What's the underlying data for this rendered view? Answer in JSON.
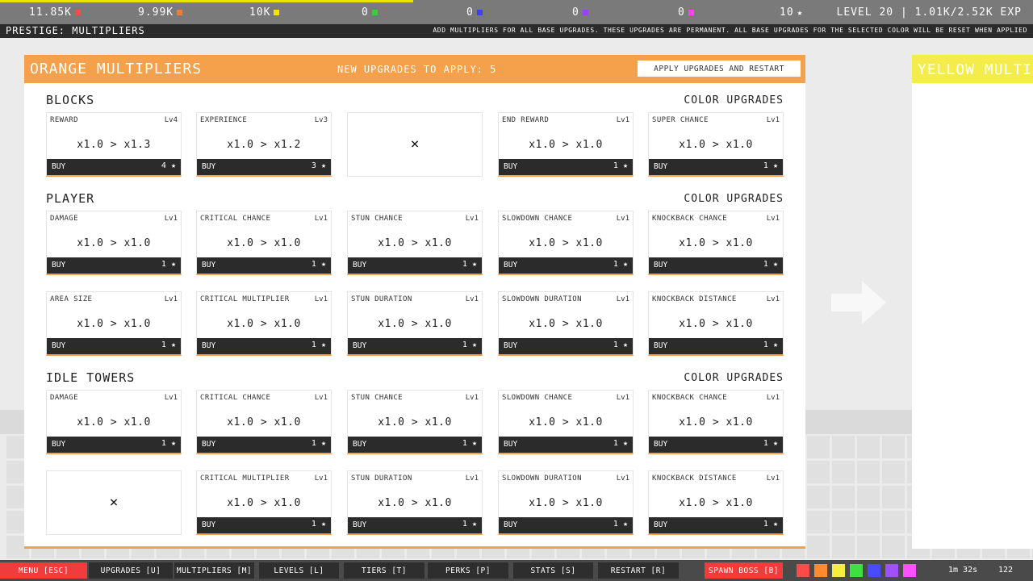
{
  "top": {
    "resources": [
      {
        "value": "11.85K",
        "color": "#ff4a4a"
      },
      {
        "value": "9.99K",
        "color": "#ff7a30"
      },
      {
        "value": "10K",
        "color": "#f5e400"
      },
      {
        "value": "0",
        "color": "#38d038"
      },
      {
        "value": "0",
        "color": "#4040ff"
      },
      {
        "value": "0",
        "color": "#a040ff"
      },
      {
        "value": "0",
        "color": "#ff40ff"
      }
    ],
    "stars": "10",
    "level": "LEVEL 20 | 1.01K/2.52K EXP",
    "exp_progress": 0.4
  },
  "subbar": {
    "title": "PRESTIGE: MULTIPLIERS",
    "hint": "ADD MULTIPLIERS FOR ALL BASE UPGRADES. THESE UPGRADES ARE PERMANENT. ALL BASE UPGRADES FOR THE SELECTED COLOR WILL BE RESET WHEN APPLIED"
  },
  "panel": {
    "title": "ORANGE MULTIPLIERS",
    "new_upgrades": "NEW UPGRADES TO APPLY: 5",
    "apply_label": "APPLY UPGRADES AND RESTART",
    "accent": "#f5a04a",
    "sections": [
      {
        "title": "BLOCKS",
        "right": "COLOR UPGRADES"
      },
      {
        "title": "PLAYER",
        "right": "COLOR UPGRADES"
      },
      {
        "title": "IDLE TOWERS",
        "right": "COLOR UPGRADES"
      }
    ],
    "buy_label": "BUY",
    "empty_mark": "×",
    "cards": [
      {
        "name": "REWARD",
        "lvl": "Lv4",
        "val": "x1.0 > x1.3",
        "cost": "4"
      },
      {
        "name": "EXPERIENCE",
        "lvl": "Lv3",
        "val": "x1.0 > x1.2",
        "cost": "3"
      },
      {
        "empty": true
      },
      {
        "name": "END REWARD",
        "lvl": "Lv1",
        "val": "x1.0 > x1.0",
        "cost": "1"
      },
      {
        "name": "SUPER CHANCE",
        "lvl": "Lv1",
        "val": "x1.0 > x1.0",
        "cost": "1"
      },
      {
        "name": "DAMAGE",
        "lvl": "Lv1",
        "val": "x1.0 > x1.0",
        "cost": "1"
      },
      {
        "name": "CRITICAL CHANCE",
        "lvl": "Lv1",
        "val": "x1.0 > x1.0",
        "cost": "1"
      },
      {
        "name": "STUN CHANCE",
        "lvl": "Lv1",
        "val": "x1.0 > x1.0",
        "cost": "1"
      },
      {
        "name": "SLOWDOWN CHANCE",
        "lvl": "Lv1",
        "val": "x1.0 > x1.0",
        "cost": "1"
      },
      {
        "name": "KNOCKBACK CHANCE",
        "lvl": "Lv1",
        "val": "x1.0 > x1.0",
        "cost": "1"
      },
      {
        "name": "AREA SIZE",
        "lvl": "Lv1",
        "val": "x1.0 > x1.0",
        "cost": "1"
      },
      {
        "name": "CRITICAL MULTIPLIER",
        "lvl": "Lv1",
        "val": "x1.0 > x1.0",
        "cost": "1"
      },
      {
        "name": "STUN DURATION",
        "lvl": "Lv1",
        "val": "x1.0 > x1.0",
        "cost": "1"
      },
      {
        "name": "SLOWDOWN DURATION",
        "lvl": "Lv1",
        "val": "x1.0 > x1.0",
        "cost": "1"
      },
      {
        "name": "KNOCKBACK DISTANCE",
        "lvl": "Lv1",
        "val": "x1.0 > x1.0",
        "cost": "1"
      },
      {
        "name": "DAMAGE",
        "lvl": "Lv1",
        "val": "x1.0 > x1.0",
        "cost": "1"
      },
      {
        "name": "CRITICAL CHANCE",
        "lvl": "Lv1",
        "val": "x1.0 > x1.0",
        "cost": "1"
      },
      {
        "name": "STUN CHANCE",
        "lvl": "Lv1",
        "val": "x1.0 > x1.0",
        "cost": "1"
      },
      {
        "name": "SLOWDOWN CHANCE",
        "lvl": "Lv1",
        "val": "x1.0 > x1.0",
        "cost": "1"
      },
      {
        "name": "KNOCKBACK CHANCE",
        "lvl": "Lv1",
        "val": "x1.0 > x1.0",
        "cost": "1"
      },
      {
        "empty": true
      },
      {
        "name": "CRITICAL MULTIPLIER",
        "lvl": "Lv1",
        "val": "x1.0 > x1.0",
        "cost": "1"
      },
      {
        "name": "STUN DURATION",
        "lvl": "Lv1",
        "val": "x1.0 > x1.0",
        "cost": "1"
      },
      {
        "name": "SLOWDOWN DURATION",
        "lvl": "Lv1",
        "val": "x1.0 > x1.0",
        "cost": "1"
      },
      {
        "name": "KNOCKBACK DISTANCE",
        "lvl": "Lv1",
        "val": "x1.0 > x1.0",
        "cost": "1"
      }
    ]
  },
  "side_panel": {
    "title": "YELLOW MULTI",
    "accent": "#f3ec4a"
  },
  "nav": {
    "buttons": [
      "MENU [ESC]",
      "UPGRADES [U]",
      "MULTIPLIERS [M]",
      "LEVELS [L]",
      "TIERS [T]",
      "PERKS [P]",
      "STATS [S]",
      "RESTART [R]",
      "SPAWN BOSS [B]"
    ],
    "swatches": [
      "#ff4a4a",
      "#ff8a30",
      "#f5ee40",
      "#40e040",
      "#4a4aff",
      "#a050ff",
      "#ff50ff"
    ],
    "timer": "1m 32s",
    "fps": "122"
  }
}
